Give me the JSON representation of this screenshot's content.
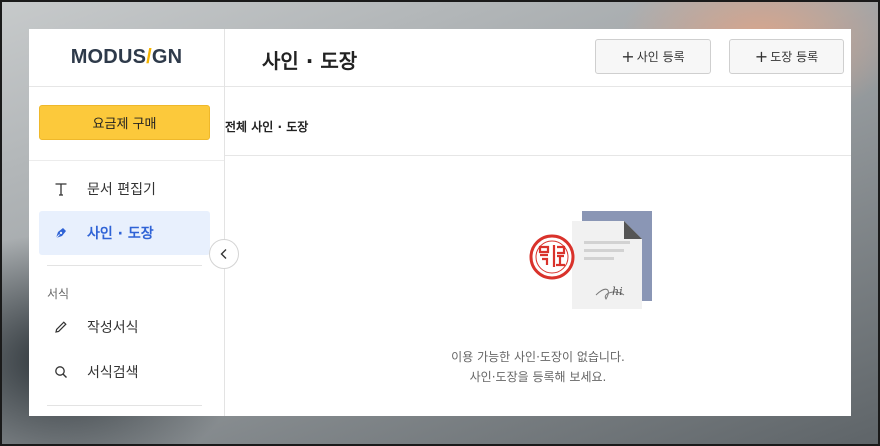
{
  "sidebar": {
    "logo_left": "MODUS",
    "logo_slash": "/",
    "logo_right": "GN",
    "buy_button": "요금제 구매",
    "items": [
      {
        "label": "문서 편집기",
        "icon": "text-t-icon"
      },
      {
        "label": "사인 · 도장",
        "icon": "pen-nib-icon",
        "active": true
      }
    ],
    "section_label": "서식",
    "section_items": [
      {
        "label": "작성서식",
        "icon": "pencil-icon"
      },
      {
        "label": "서식검색",
        "icon": "search-icon"
      }
    ]
  },
  "header": {
    "title": "사인 · 도장",
    "add_sign_button": "사인 등록",
    "add_stamp_button": "도장 등록",
    "plus_glyph": "+"
  },
  "filter": {
    "label": "전체 사인 · 도장"
  },
  "empty_state": {
    "line1": "이용 가능한 사인·도장이 없습니다.",
    "line2": "사인·도장을 등록해 보세요.",
    "signature_text": "hi"
  },
  "colors": {
    "accent": "#2f63d6",
    "buy_button": "#fcc93b",
    "stamp_red": "#d9322b",
    "doc_back": "#8a96b5",
    "logo_slash": "#f5b400"
  }
}
